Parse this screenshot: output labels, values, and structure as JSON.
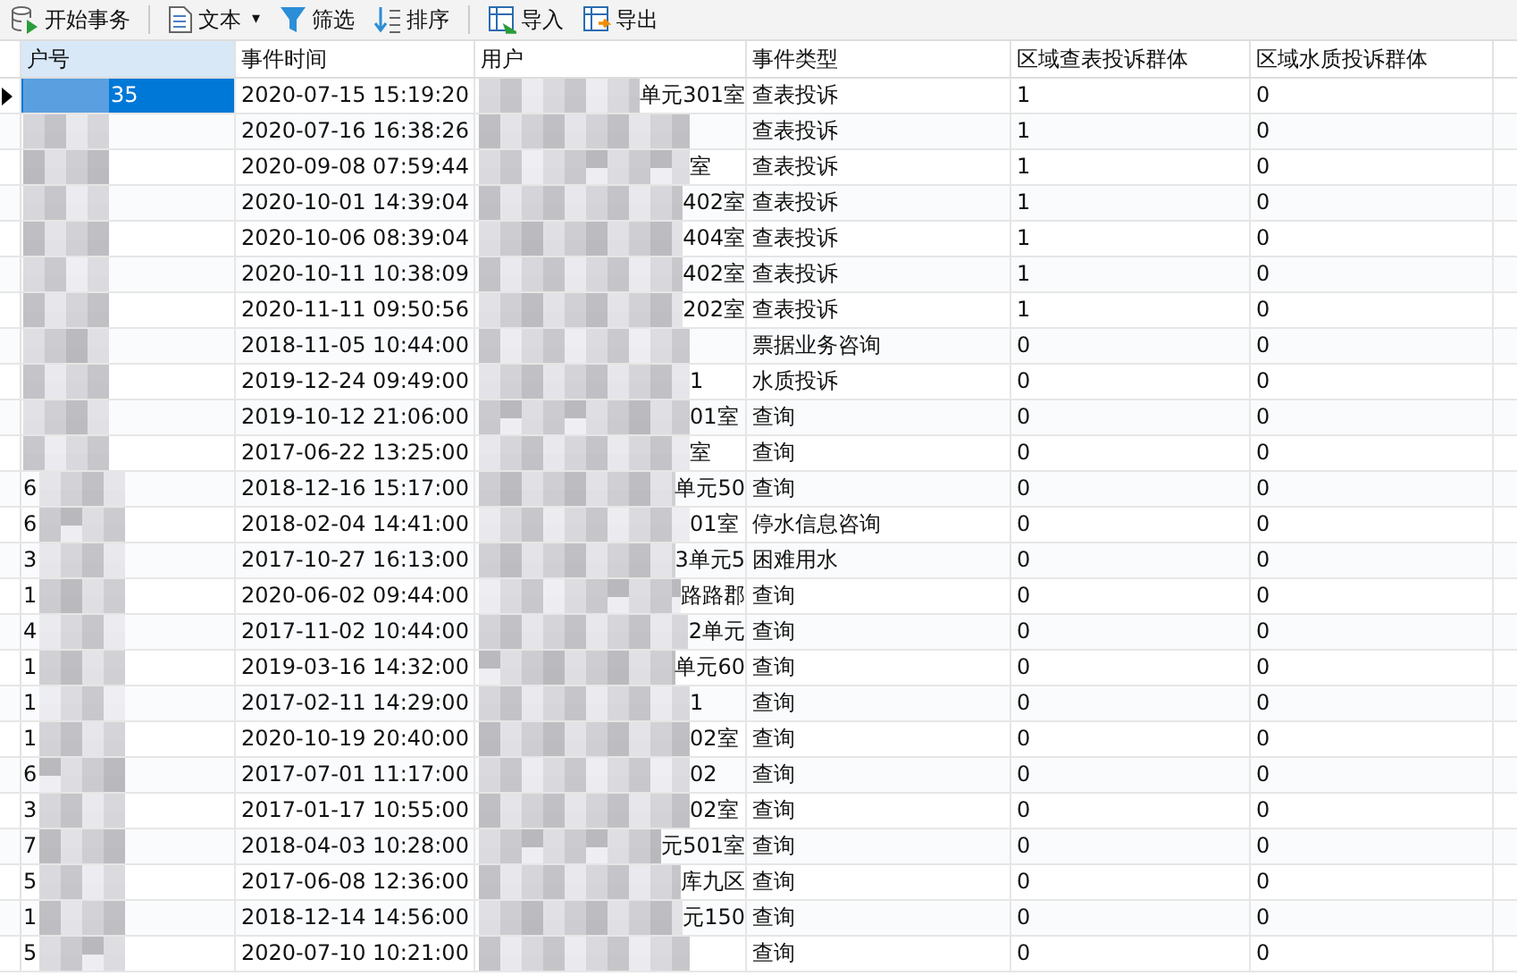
{
  "toolbar": [
    {
      "kind": "db",
      "label": "开始事务"
    },
    {
      "kind": "divider"
    },
    {
      "kind": "text",
      "label": "文本",
      "caret": "▾"
    },
    {
      "kind": "filter",
      "label": "筛选"
    },
    {
      "kind": "sort",
      "label": "排序"
    },
    {
      "kind": "divider"
    },
    {
      "kind": "import",
      "label": "导入"
    },
    {
      "kind": "export",
      "label": "导出"
    }
  ],
  "table": {
    "columns": [
      {
        "label": "户号",
        "selected": true
      },
      {
        "label": "事件时间",
        "selected": false
      },
      {
        "label": "用户",
        "selected": false
      },
      {
        "label": "事件类型",
        "selected": false
      },
      {
        "label": "区域查表投诉群体",
        "selected": false
      },
      {
        "label": "区域水质投诉群体",
        "selected": false
      }
    ],
    "rows": [
      {
        "selected": true,
        "account_suffix": "35",
        "time": "2020-07-15 15:19:20",
        "address": "单元301室",
        "event_type": "查表投诉",
        "column_5": "1",
        "column_6": "0"
      },
      {
        "selected": false,
        "time": "2020-07-16 16:38:26",
        "event_type": "查表投诉",
        "column_5": "1",
        "column_6": "0"
      },
      {
        "selected": false,
        "time": "2020-09-08 07:59:44",
        "address": "室",
        "event_type": "查表投诉",
        "column_5": "1",
        "column_6": "0"
      },
      {
        "selected": false,
        "time": "2020-10-01 14:39:04",
        "address": "402室",
        "event_type": "查表投诉",
        "column_5": "1",
        "column_6": "0"
      },
      {
        "selected": false,
        "time": "2020-10-06 08:39:04",
        "address": "404室",
        "event_type": "查表投诉",
        "column_5": "1",
        "column_6": "0"
      },
      {
        "selected": false,
        "time": "2020-10-11 10:38:09",
        "address": "402室",
        "event_type": "查表投诉",
        "column_5": "1",
        "column_6": "0"
      },
      {
        "selected": false,
        "time": "2020-11-11 09:50:56",
        "address": "202室",
        "event_type": "查表投诉",
        "column_5": "1",
        "column_6": "0"
      },
      {
        "selected": false,
        "time": "2018-11-05 10:44:00",
        "event_type": "票据业务咨询",
        "column_5": "0",
        "column_6": "0"
      },
      {
        "selected": false,
        "time": "2019-12-24 09:49:00",
        "address": "1",
        "event_type": "水质投诉",
        "column_5": "0",
        "column_6": "0"
      },
      {
        "selected": false,
        "time": "2019-10-12 21:06:00",
        "address": "01室",
        "event_type": "查询",
        "column_5": "0",
        "column_6": "0"
      },
      {
        "selected": false,
        "time": "2017-06-22 13:25:00",
        "address": "室",
        "event_type": "查询",
        "column_5": "0",
        "column_6": "0"
      },
      {
        "selected": false,
        "account_prefix": "6",
        "time": "2018-12-16 15:17:00",
        "address": "单元50",
        "event_type": "查询",
        "column_5": "0",
        "column_6": "0"
      },
      {
        "selected": false,
        "account_prefix": "6",
        "time": "2018-02-04 14:41:00",
        "address": "01室",
        "event_type": "停水信息咨询",
        "column_5": "0",
        "column_6": "0"
      },
      {
        "selected": false,
        "account_prefix": "3",
        "time": "2017-10-27 16:13:00",
        "address": "3单元5",
        "event_type": "困难用水",
        "column_5": "0",
        "column_6": "0"
      },
      {
        "selected": false,
        "account_prefix": "1",
        "time": "2020-06-02 09:44:00",
        "address": "路路郡",
        "event_type": "查询",
        "column_5": "0",
        "column_6": "0"
      },
      {
        "selected": false,
        "account_prefix": "4",
        "time": "2017-11-02 10:44:00",
        "address": "2单元",
        "event_type": "查询",
        "column_5": "0",
        "column_6": "0"
      },
      {
        "selected": false,
        "account_prefix": "1",
        "time": "2019-03-16 14:32:00",
        "address": "单元60",
        "event_type": "查询",
        "column_5": "0",
        "column_6": "0"
      },
      {
        "selected": false,
        "account_prefix": "1",
        "time": "2017-02-11 14:29:00",
        "address": "1",
        "event_type": "查询",
        "column_5": "0",
        "column_6": "0"
      },
      {
        "selected": false,
        "account_prefix": "1",
        "time": "2020-10-19 20:40:00",
        "address": "02室",
        "event_type": "查询",
        "column_5": "0",
        "column_6": "0"
      },
      {
        "selected": false,
        "account_prefix": "6",
        "time": "2017-07-01 11:17:00",
        "address": "02",
        "event_type": "查询",
        "column_5": "0",
        "column_6": "0"
      },
      {
        "selected": false,
        "account_prefix": "3",
        "time": "2017-01-17 10:55:00",
        "address": "02室",
        "event_type": "查询",
        "column_5": "0",
        "column_6": "0"
      },
      {
        "selected": false,
        "account_prefix": "7",
        "time": "2018-04-03 10:28:00",
        "address": "元501室",
        "event_type": "查询",
        "column_5": "0",
        "column_6": "0"
      },
      {
        "selected": false,
        "account_prefix": "5",
        "time": "2017-06-08 12:36:00",
        "address": "库九区",
        "event_type": "查询",
        "column_5": "0",
        "column_6": "0"
      },
      {
        "selected": false,
        "account_prefix": "1",
        "time": "2018-12-14 14:56:00",
        "address": "元150",
        "event_type": "查询",
        "column_5": "0",
        "column_6": "0"
      },
      {
        "selected": false,
        "account_prefix": "5",
        "time": "2020-07-10 10:21:00",
        "event_type": "查询",
        "column_5": "0",
        "column_6": "0"
      }
    ]
  }
}
